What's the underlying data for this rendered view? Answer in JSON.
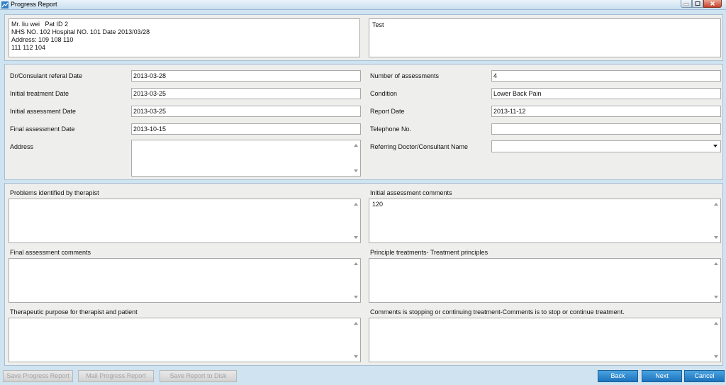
{
  "window": {
    "title": "Progress Report",
    "app_icon": "report-chart-icon"
  },
  "patient_info": {
    "line1": "Mr. liu wei   Pat ID 2",
    "line2": "NHS NO. 102 Hospital NO. 101 Date 2013/03/28",
    "line3": "Address: 109 108 110",
    "line4": "111 112 104"
  },
  "note_box": {
    "value": "Test"
  },
  "left_fields": {
    "referral_label": "Dr/Consulant referal Date",
    "referral_value": "2013-03-28",
    "initial_treatment_label": "Initial treatment Date",
    "initial_treatment_value": "2013-03-25",
    "initial_assessment_label": "Initial assessment Date",
    "initial_assessment_value": "2013-03-25",
    "final_assessment_label": "Final assessment Date",
    "final_assessment_value": "2013-10-15",
    "address_label": "Address",
    "address_value": ""
  },
  "right_fields": {
    "num_assessments_label": "Number of assessments",
    "num_assessments_value": "4",
    "condition_label": "Condition",
    "condition_value": "Lower Back Pain",
    "report_date_label": "Report Date",
    "report_date_value": "2013-11-12",
    "telephone_label": "Telephone No.",
    "telephone_value": "",
    "referring_doctor_label": "Referring Doctor/Consultant Name",
    "referring_doctor_value": ""
  },
  "comments": {
    "problems_label": "Problems identified by therapist",
    "problems_value": "",
    "initial_comments_label": "Initial assessment comments",
    "initial_comments_value": "120",
    "final_comments_label": "Final assessment comments",
    "final_comments_value": "",
    "principles_label": "Principle treatments- Treatment principles",
    "principles_value": "",
    "purpose_label": "Therapeutic purpose for therapist and patient",
    "purpose_value": "",
    "stop_continue_label": "Comments is stopping or continuing treatment-Comments is to stop or continue treatment.",
    "stop_continue_value": ""
  },
  "buttons": {
    "save_report": "Save Progress Report",
    "mail_report": "Mail Progress Report",
    "save_disk": "Save Report to Disk",
    "back": "Back",
    "next": "Next",
    "cancel": "Cancel"
  },
  "colors": {
    "primary_button": "#1c73bd",
    "panel_bg": "#eeeeec",
    "window_bg": "#cfe3f1"
  }
}
